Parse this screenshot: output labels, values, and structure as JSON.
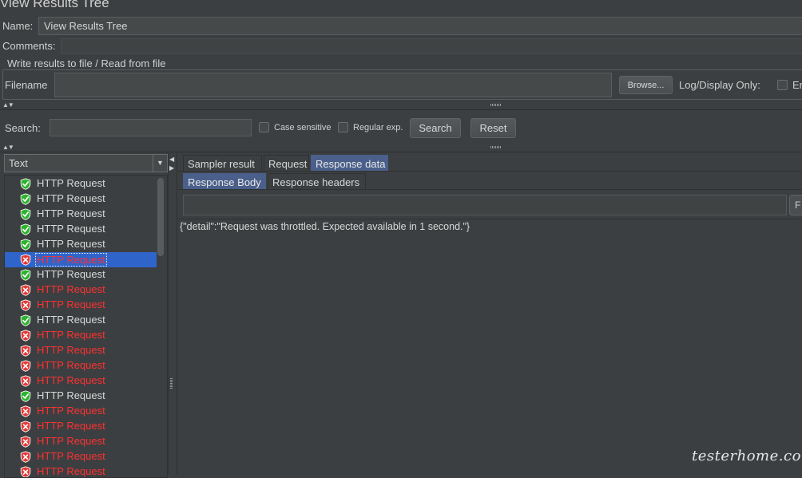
{
  "page_title": "View Results Tree",
  "name_field": {
    "label": "Name:",
    "value": "View Results Tree"
  },
  "comments_field": {
    "label": "Comments:",
    "value": ""
  },
  "write_results": {
    "title": "Write results to file / Read from file",
    "filename_label": "Filename",
    "filename_value": "",
    "browse_label": "Browse...",
    "log_display_label": "Log/Display Only:",
    "errors_label": "Er"
  },
  "search_bar": {
    "label": "Search:",
    "value": "",
    "case_sensitive_label": "Case sensitive",
    "regular_exp_label": "Regular exp.",
    "search_button": "Search",
    "reset_button": "Reset"
  },
  "view_selector": {
    "value": "Text"
  },
  "results": [
    {
      "label": "HTTP Request",
      "status": "ok"
    },
    {
      "label": "HTTP Request",
      "status": "ok"
    },
    {
      "label": "HTTP Request",
      "status": "ok"
    },
    {
      "label": "HTTP Request",
      "status": "ok"
    },
    {
      "label": "HTTP Request",
      "status": "ok"
    },
    {
      "label": "HTTP Request",
      "status": "fail",
      "selected": true
    },
    {
      "label": "HTTP Request",
      "status": "ok"
    },
    {
      "label": "HTTP Request",
      "status": "fail"
    },
    {
      "label": "HTTP Request",
      "status": "fail"
    },
    {
      "label": "HTTP Request",
      "status": "ok"
    },
    {
      "label": "HTTP Request",
      "status": "fail"
    },
    {
      "label": "HTTP Request",
      "status": "fail"
    },
    {
      "label": "HTTP Request",
      "status": "fail"
    },
    {
      "label": "HTTP Request",
      "status": "fail"
    },
    {
      "label": "HTTP Request",
      "status": "ok"
    },
    {
      "label": "HTTP Request",
      "status": "fail"
    },
    {
      "label": "HTTP Request",
      "status": "fail"
    },
    {
      "label": "HTTP Request",
      "status": "fail"
    },
    {
      "label": "HTTP Request",
      "status": "fail"
    },
    {
      "label": "HTTP Request",
      "status": "fail"
    }
  ],
  "tabs": [
    {
      "label": "Sampler result",
      "active": false
    },
    {
      "label": "Request",
      "active": false
    },
    {
      "label": "Response data",
      "active": true
    }
  ],
  "subtabs": [
    {
      "label": "Response Body",
      "active": true
    },
    {
      "label": "Response headers",
      "active": false
    }
  ],
  "response": {
    "search_value": "",
    "find_label": "F",
    "body_text": "{\"detail\":\"Request was throttled. Expected available in 1 second.\"}"
  },
  "watermark": "testerhome.com",
  "colors": {
    "background": "#3c3f41",
    "ok_icon": "#2fb32f",
    "fail_icon": "#e23a3a",
    "fail_text": "#ff3030",
    "selection": "#2f65ca",
    "active_tab": "#4a5f8a"
  }
}
